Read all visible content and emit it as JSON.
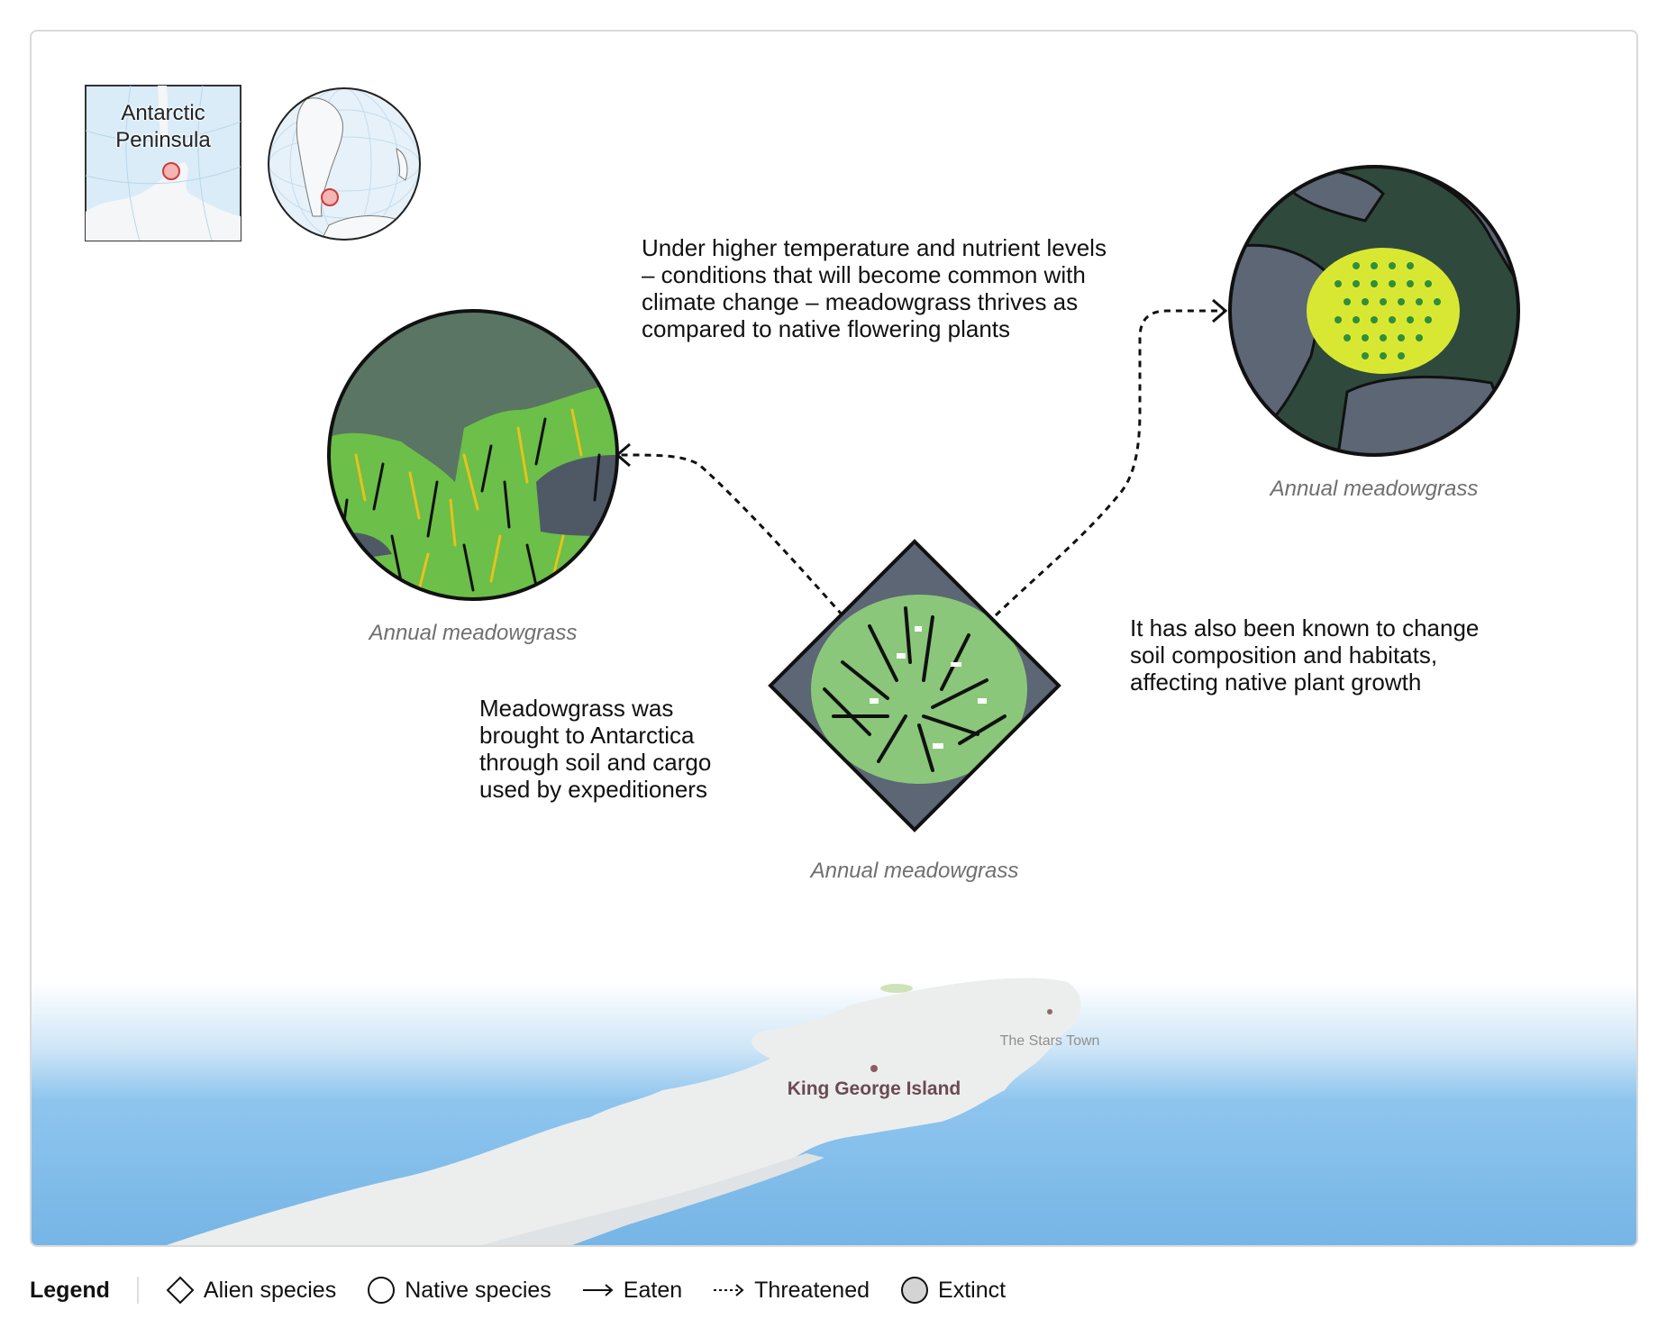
{
  "inset_label": "Antarctic Peninsula",
  "captions": [
    "Annual meadowgrass",
    "Annual meadowgrass",
    "Annual meadowgrass"
  ],
  "texts": {
    "climate": [
      "Under higher temperature and nutrient levels",
      "– conditions that will become common with",
      "climate change – meadowgrass thrives as",
      "compared to native flowering plants"
    ],
    "soil": [
      "It has also been known to change",
      "soil composition and habitats,",
      "affecting native plant growth"
    ],
    "origin": [
      "Meadowgrass was",
      "brought to Antarctica",
      "through soil and cargo",
      "used by expeditioners"
    ]
  },
  "map": {
    "place": "King George Island",
    "town": "The Stars Town"
  },
  "legend": {
    "title": "Legend",
    "items": [
      {
        "label": "Alien species",
        "icon": "diamond-icon"
      },
      {
        "label": "Native species",
        "icon": "circle-icon"
      },
      {
        "label": "Eaten",
        "icon": "solid-arrow-icon"
      },
      {
        "label": "Threatened",
        "icon": "dashed-arrow-icon"
      },
      {
        "label": "Extinct",
        "icon": "grey-circle-icon"
      }
    ]
  },
  "colors": {
    "sea": "#7cb8e8",
    "land": "#eceeee",
    "grass": "#6fbf4a",
    "rock": "#5c6675",
    "moss_bg": "#2f4a3c",
    "marker": "#e03c3c"
  }
}
